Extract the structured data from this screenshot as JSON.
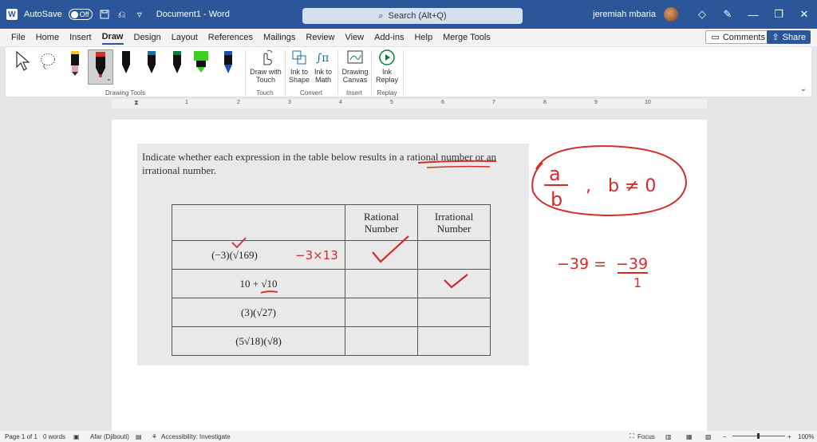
{
  "titlebar": {
    "autosave_label": "AutoSave",
    "autosave_state": "Off",
    "doc_title": "Document1  -  Word",
    "search_placeholder": "Search (Alt+Q)",
    "user_name": "jeremiah mbaria"
  },
  "menu": {
    "items": [
      "File",
      "Home",
      "Insert",
      "Draw",
      "Design",
      "Layout",
      "References",
      "Mailings",
      "Review",
      "View",
      "Add-ins",
      "Help",
      "Merge Tools"
    ],
    "active": "Draw",
    "comments_label": "Comments",
    "share_label": "Share"
  },
  "ribbon": {
    "drawing_tools_label": "Drawing Tools",
    "touch_group_label": "Touch",
    "convert_group_label": "Convert",
    "insert_group_label": "Insert",
    "replay_group_label": "Replay",
    "draw_with_touch_l1": "Draw with",
    "draw_with_touch_l2": "Touch",
    "ink_to_shape_l1": "Ink to",
    "ink_to_shape_l2": "Shape",
    "ink_to_math_l1": "Ink to",
    "ink_to_math_l2": "Math",
    "drawing_canvas_l1": "Drawing",
    "drawing_canvas_l2": "Canvas",
    "ink_replay_l1": "Ink",
    "ink_replay_l2": "Replay",
    "pen_colors": [
      "#f5c518",
      "#d42b2b",
      "#111111",
      "#1a6fa8",
      "#0b7a3a",
      "#39d31e",
      "#1a4fb8"
    ]
  },
  "ruler": {
    "numbers": [
      "1",
      "2",
      "3",
      "4",
      "5",
      "6",
      "7",
      "8",
      "9",
      "10"
    ]
  },
  "document": {
    "question_line1": "Indicate whether each expression in the table below results in a rational number or an",
    "question_line2": "irrational number.",
    "table": {
      "header_rational_l1": "Rational",
      "header_rational_l2": "Number",
      "header_irrational_l1": "Irrational",
      "header_irrational_l2": "Number",
      "rows": [
        "(−3)(√169)",
        "10 + √10",
        "(3)(√27)",
        "(5√18)(√8)"
      ]
    },
    "handwritten": {
      "annotation_row1": "−3×13",
      "fraction_num": "a",
      "fraction_den": "b",
      "condition": "b ≠ 0",
      "equation_lhs": "−39 =",
      "equation_num": "−39",
      "equation_den": "1"
    }
  },
  "statusbar": {
    "page": "Page 1 of 1",
    "words": "0 words",
    "language": "Afar (Djibouti)",
    "accessibility": "Accessibility: Investigate",
    "focus": "Focus",
    "zoom": "100%"
  }
}
